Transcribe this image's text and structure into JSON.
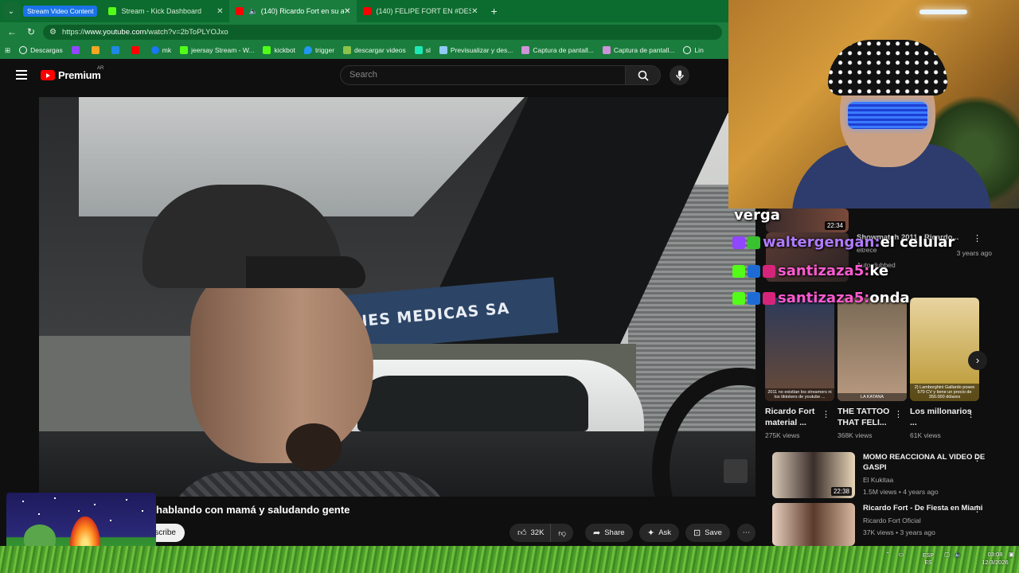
{
  "browser": {
    "tab_group_label": "Stream Video Content",
    "tabs": [
      {
        "label": "Stream - Kick Dashboard",
        "color": "#53fc18"
      },
      {
        "label": "(140) Ricardo Fort en su auto",
        "color": "#ff0000"
      },
      {
        "label": "(140) FELIPE FORT EN #DESENCRI",
        "color": "#ff0000"
      }
    ],
    "url_prefix": "https://",
    "url_host": "www.youtube.com",
    "url_path": "/watch?v=2bToPLYOJxo",
    "bookmarks": [
      {
        "label": "Descargas",
        "icon": "globe-icon",
        "color": "#cfe"
      },
      {
        "label": "",
        "icon": "twitch-icon",
        "color": "#9146ff"
      },
      {
        "label": "",
        "icon": "orange-icon",
        "color": "#f5a623"
      },
      {
        "label": "",
        "icon": "blue-icon",
        "color": "#1e88e5"
      },
      {
        "label": "",
        "icon": "youtube-icon",
        "color": "#ff0000"
      },
      {
        "label": "mk",
        "icon": "facebook-icon",
        "color": "#1877f2"
      },
      {
        "label": "jeersay Stream - W...",
        "icon": "kick-icon",
        "color": "#53fc18"
      },
      {
        "label": "kickbot",
        "icon": "kick-icon",
        "color": "#53fc18"
      },
      {
        "label": "trigger",
        "icon": "drop-icon",
        "color": "#2196f3"
      },
      {
        "label": "descargar videos",
        "icon": "download-icon",
        "color": "#8bc34a"
      },
      {
        "label": "sl",
        "icon": "sl-icon",
        "color": "#1de9b6"
      },
      {
        "label": "Previsualizar y des...",
        "icon": "rp-icon",
        "color": "#90caf9"
      },
      {
        "label": "Captura de pantall...",
        "icon": "pen-icon",
        "color": "#ce93d8"
      },
      {
        "label": "Captura de pantall...",
        "icon": "pen-icon",
        "color": "#ce93d8"
      },
      {
        "label": "Lin",
        "icon": "globe-icon",
        "color": "#cfe"
      }
    ]
  },
  "youtube": {
    "logo_text": "Premium",
    "logo_region": "AR",
    "search_placeholder": "Search",
    "video_sign_text": "AGENES MEDICAS SA",
    "video_title": "hablando con mamá y saludando gente",
    "subscribe_label": "scribe",
    "like_count": "32K",
    "share_label": "Share",
    "ask_label": "Ask",
    "save_label": "Save"
  },
  "sidebar": {
    "videos": [
      {
        "title": "Showmatch 2011 - Ricardo...",
        "channel": "eltrece",
        "meta": "3 years ago",
        "extra": "Auto-dubbed",
        "duration": "22:34"
      },
      {
        "title": "MOMO REACCIONA AL VIDEO DE GASPI",
        "channel": "El Kukitaa",
        "meta": "1.5M views • 4 years ago",
        "duration": "22:38"
      },
      {
        "title": "Ricardo Fort - De Fiesta en Miami",
        "channel": "Ricardo Fort Oficial",
        "meta": "37K views • 3 years ago",
        "duration": ""
      }
    ],
    "shorts": [
      {
        "title": "Ricardo Fort material ...",
        "views": "275K views",
        "caption": "2011 no existían los streamers ni los tiktokers de youtube ...",
        "color": "#6a4a36"
      },
      {
        "title": "THE TATTOO THAT FELI...",
        "views": "368K views",
        "caption": "LA KATANA",
        "color": "#b99a80"
      },
      {
        "title": "Los millonarios ...",
        "views": "61K views",
        "caption": "2) Lamborghini Gallardo posee 570 CV y tiene un precio de 350.000 dólares",
        "color": "#b8962e"
      }
    ]
  },
  "chat": [
    {
      "user": "",
      "message": "verga"
    },
    {
      "user": "waltergengan:",
      "message": "el celular"
    },
    {
      "user": "santizaza5:",
      "message": "ke"
    },
    {
      "user": "santizaza5:",
      "message": "onda"
    }
  ],
  "taskbar": {
    "lang_top": "ESP",
    "lang_bottom": "ES",
    "time": "03:08",
    "date": "12/3/2026"
  }
}
